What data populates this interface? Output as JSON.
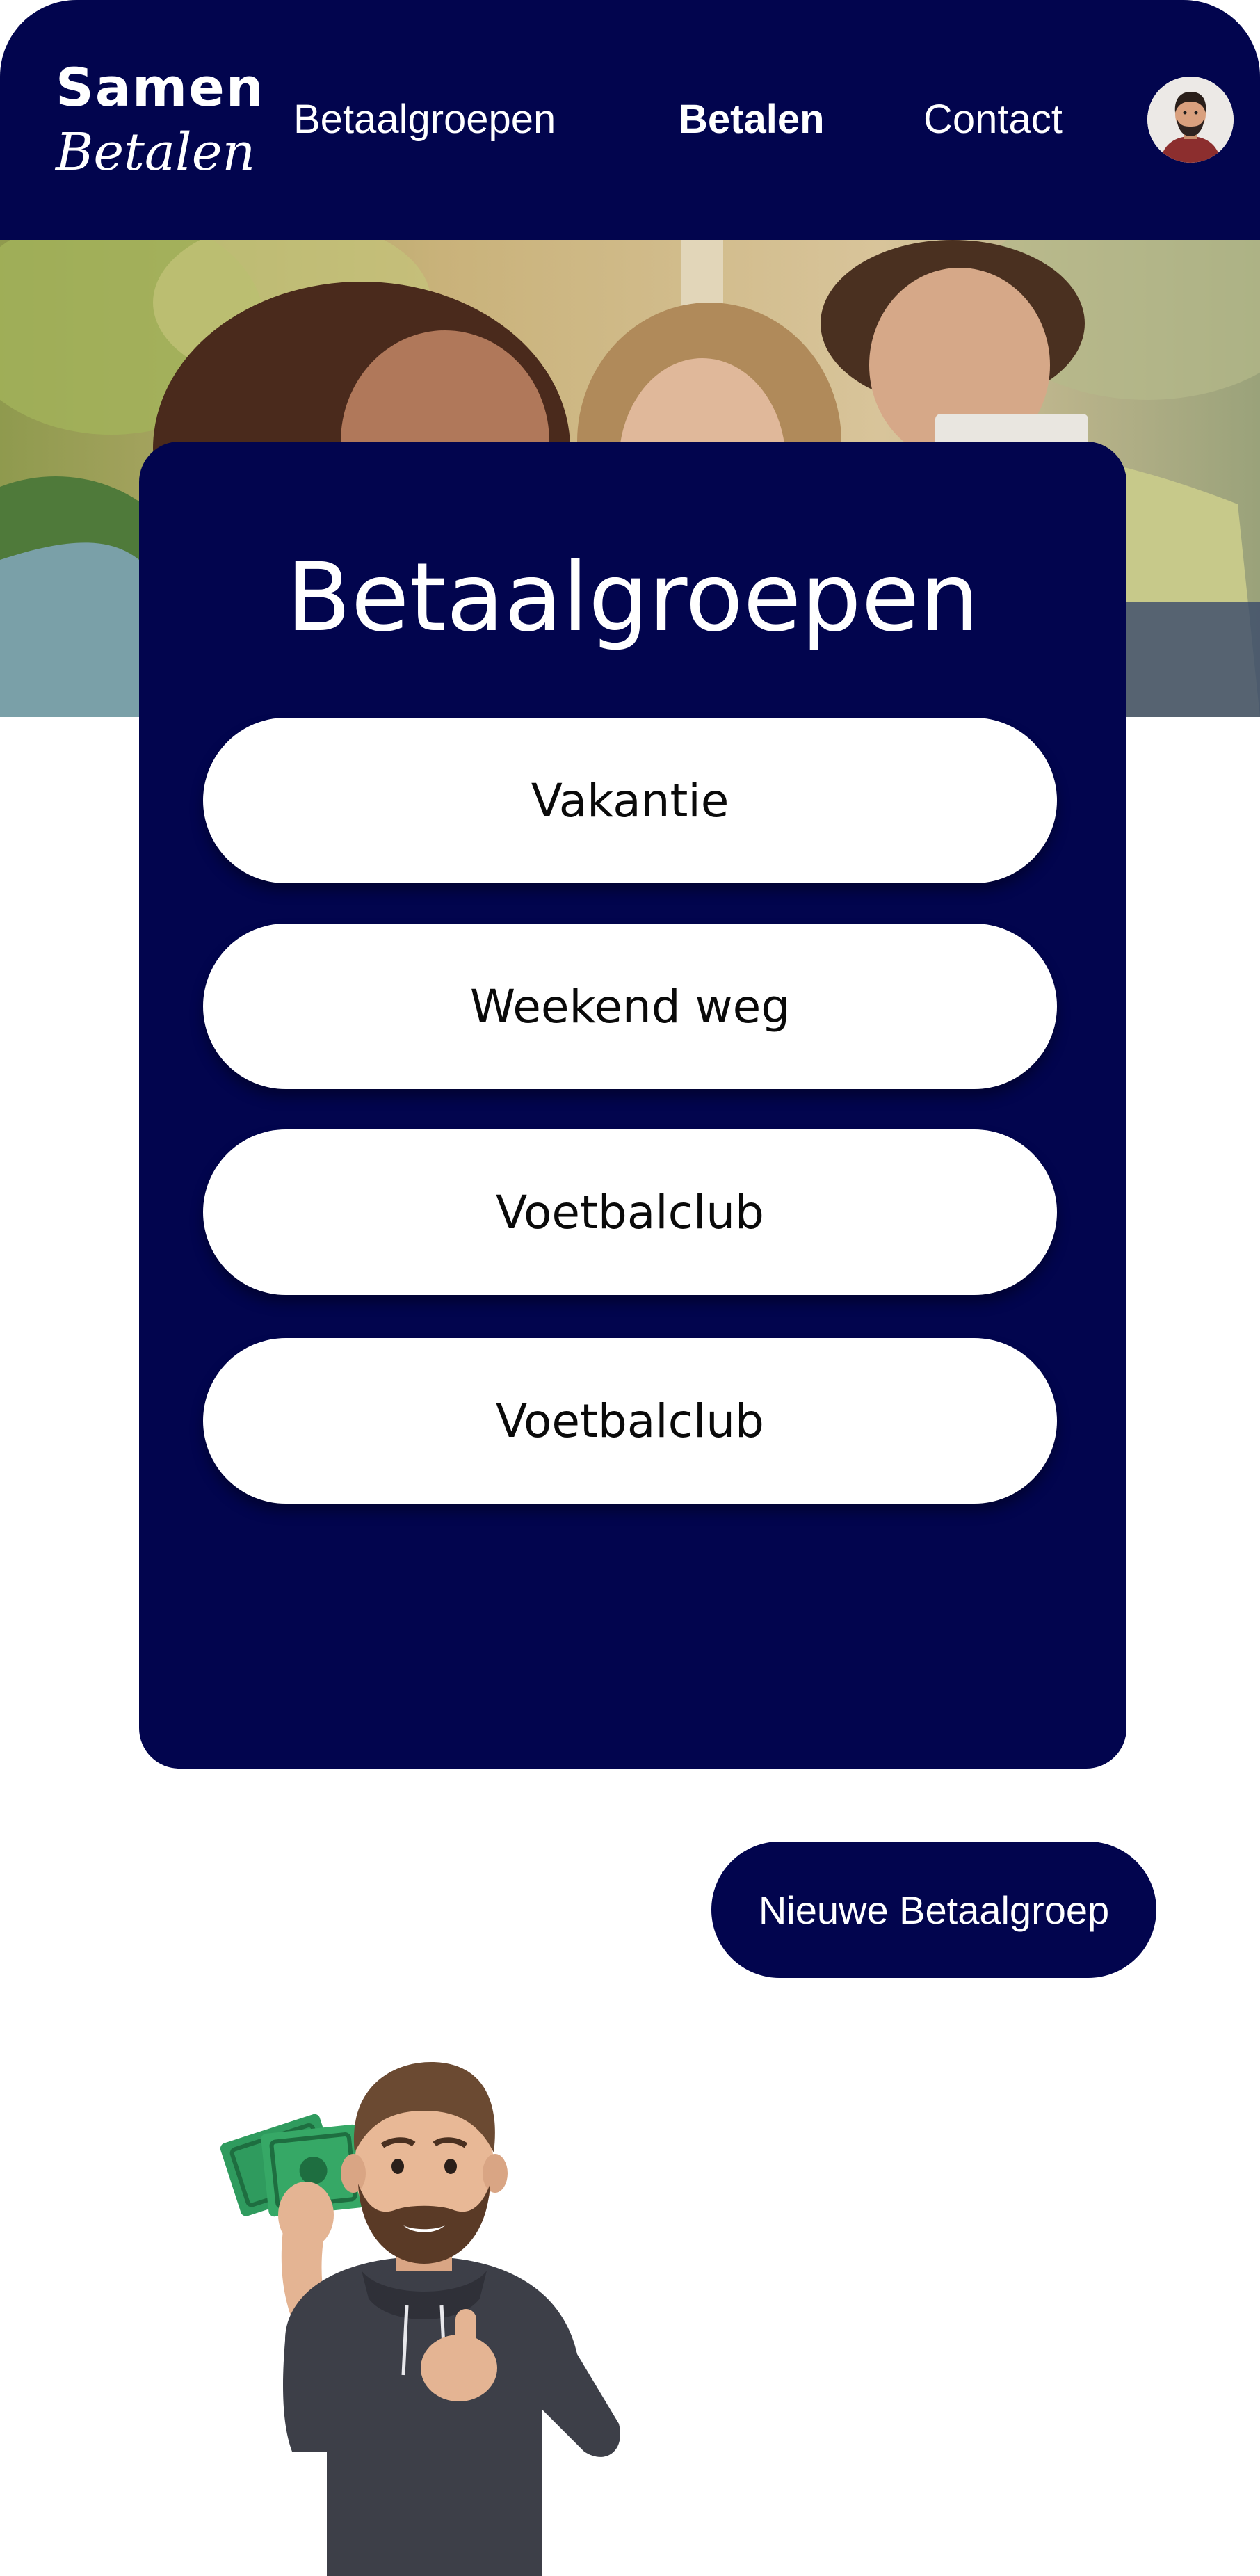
{
  "header": {
    "logo": {
      "line1": "Samen",
      "line2": "Betalen"
    },
    "nav": {
      "betaalgroepen": "Betaalgroepen",
      "betalen": "Betalen",
      "contact": "Contact"
    },
    "avatar_icon": "user-avatar-icon"
  },
  "hero": {
    "image": "friends-group-photo"
  },
  "groups": {
    "title": "Betaalgroepen",
    "items": [
      {
        "label": "Vakantie"
      },
      {
        "label": "Weekend weg"
      },
      {
        "label": "Voetbalclub"
      },
      {
        "label": "Voetbalclub"
      }
    ]
  },
  "actions": {
    "new_group_label": "Nieuwe Betaalgroep"
  },
  "illustration": {
    "image": "man-with-money-thumbs-up"
  },
  "colors": {
    "brand_navy": "#02054e",
    "button_white": "#ffffff",
    "text_dark": "#0a0a0a"
  }
}
